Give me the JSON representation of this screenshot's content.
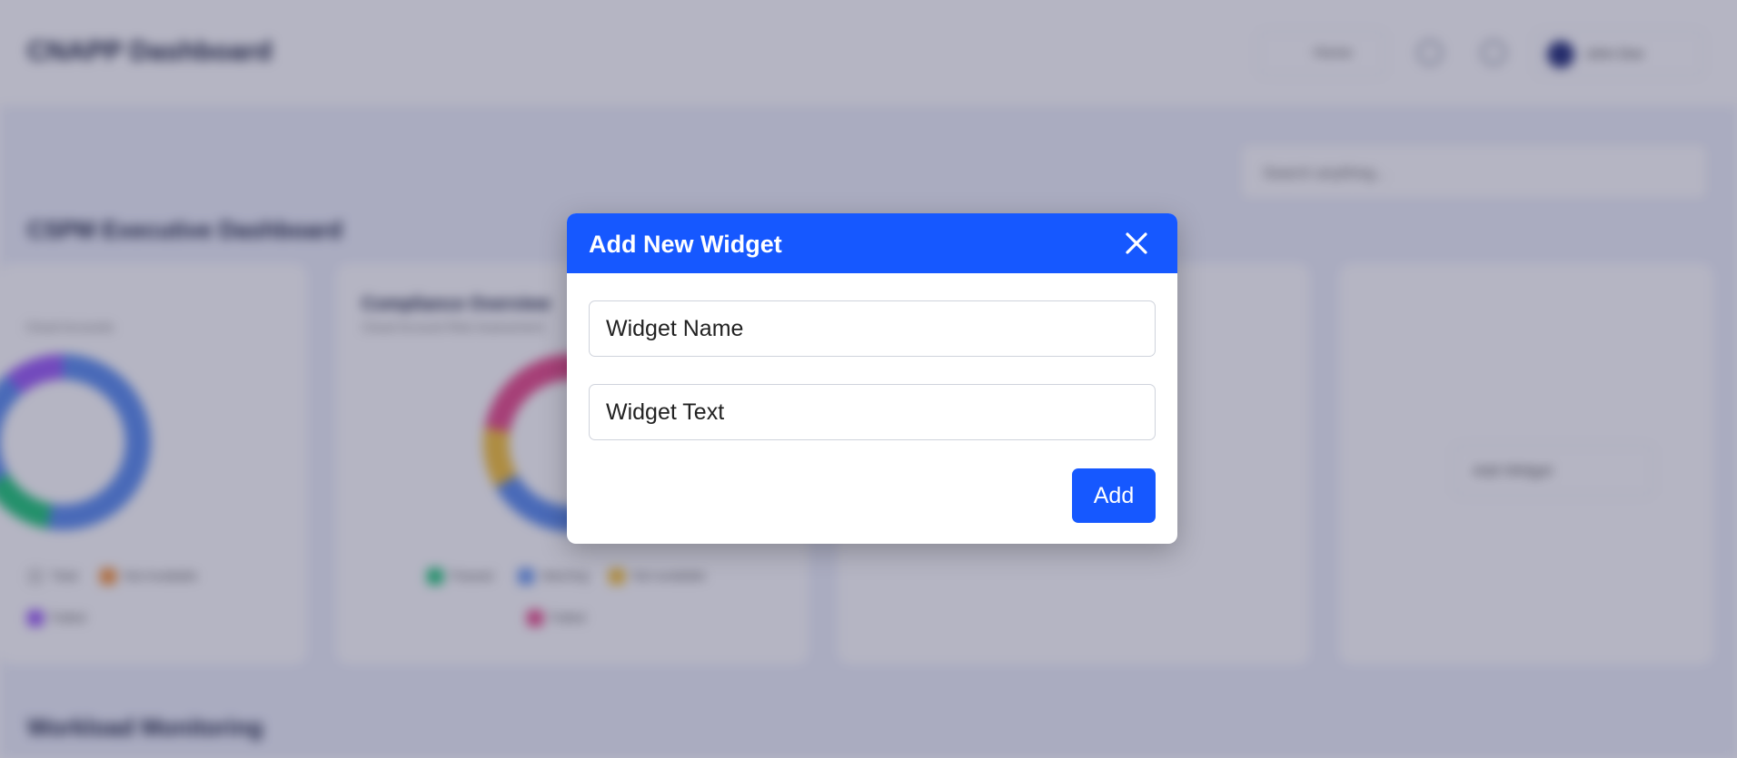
{
  "background": {
    "app_title": "CNAPP Dashboard",
    "breadcrumb": "Home",
    "user_name": "John Doe",
    "search_placeholder": "Search anything...",
    "dashboard_title": "CNAPP Dashboard",
    "sections": [
      "CSPM Executive Dashboard",
      "Workload Monitoring"
    ],
    "cards": [
      {
        "title": "",
        "subtitle": "Cloud Accounts",
        "legend": [
          {
            "label": "Total",
            "color": "#dddddd"
          },
          {
            "label": "Not Available",
            "color": "#f6943c"
          },
          {
            "label": "Failed",
            "color": "#9b5cf6"
          }
        ]
      },
      {
        "title": "Compliance Overview",
        "subtitle": "Cloud Account Risk Assessment",
        "legend": [
          {
            "label": "Passed",
            "color": "#22c77a"
          },
          {
            "label": "Warning",
            "color": "#6f9cf0"
          },
          {
            "label": "Not available",
            "color": "#f5c23c"
          },
          {
            "label": "Failed",
            "color": "#e94d8c"
          }
        ]
      }
    ],
    "add_widget_label": "Add Widget"
  },
  "modal": {
    "title": "Add New Widget",
    "widget_name_placeholder": "Widget Name",
    "widget_text_placeholder": "Widget Text",
    "add_label": "Add"
  },
  "colors": {
    "primary": "#1658ff",
    "overlay": "rgba(38,38,80,0.34)",
    "page_bg": "#eef1fb"
  }
}
